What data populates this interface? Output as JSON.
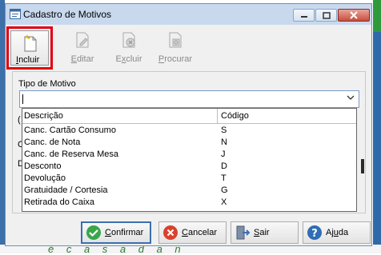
{
  "window": {
    "title": "Cadastro de Motivos"
  },
  "toolbar": {
    "incluir": {
      "pre": "",
      "u": "I",
      "post": "ncluir"
    },
    "editar": {
      "pre": "",
      "u": "E",
      "post": "ditar"
    },
    "excluir": {
      "pre": "E",
      "u": "x",
      "post": "cluir"
    },
    "procurar": {
      "pre": "",
      "u": "P",
      "post": "rocurar"
    }
  },
  "form": {
    "tipo_label": "Tipo de Motivo",
    "tipo_value": "",
    "side_marks": [
      "(",
      "C",
      "D"
    ]
  },
  "dropdown": {
    "columns": [
      "Descrição",
      "Código"
    ],
    "rows": [
      {
        "descricao": "Canc. Cartão Consumo",
        "codigo": "S"
      },
      {
        "descricao": "Canc. de Nota",
        "codigo": "N"
      },
      {
        "descricao": "Canc. de Reserva Mesa",
        "codigo": "J"
      },
      {
        "descricao": "Desconto",
        "codigo": "D"
      },
      {
        "descricao": "Devolução",
        "codigo": "T"
      },
      {
        "descricao": "Gratuidade / Cortesia",
        "codigo": "G"
      },
      {
        "descricao": "Retirada do Caixa",
        "codigo": "X"
      }
    ]
  },
  "buttons": {
    "confirmar": {
      "pre": "",
      "u": "C",
      "post": "onfirmar"
    },
    "cancelar": {
      "pre": "",
      "u": "C",
      "post": "ancelar"
    },
    "sair": {
      "pre": "",
      "u": "S",
      "post": "air"
    },
    "ajuda": {
      "pre": "Aj",
      "u": "u",
      "post": "da"
    }
  },
  "colors": {
    "highlight_border": "#e00010",
    "titlebar": "#c8d9ee",
    "confirm_icon": "#3aa64a",
    "cancel_icon": "#d9412c",
    "help_icon": "#2f6db5"
  },
  "background": {
    "footer_text": "é c a s a d a n"
  }
}
